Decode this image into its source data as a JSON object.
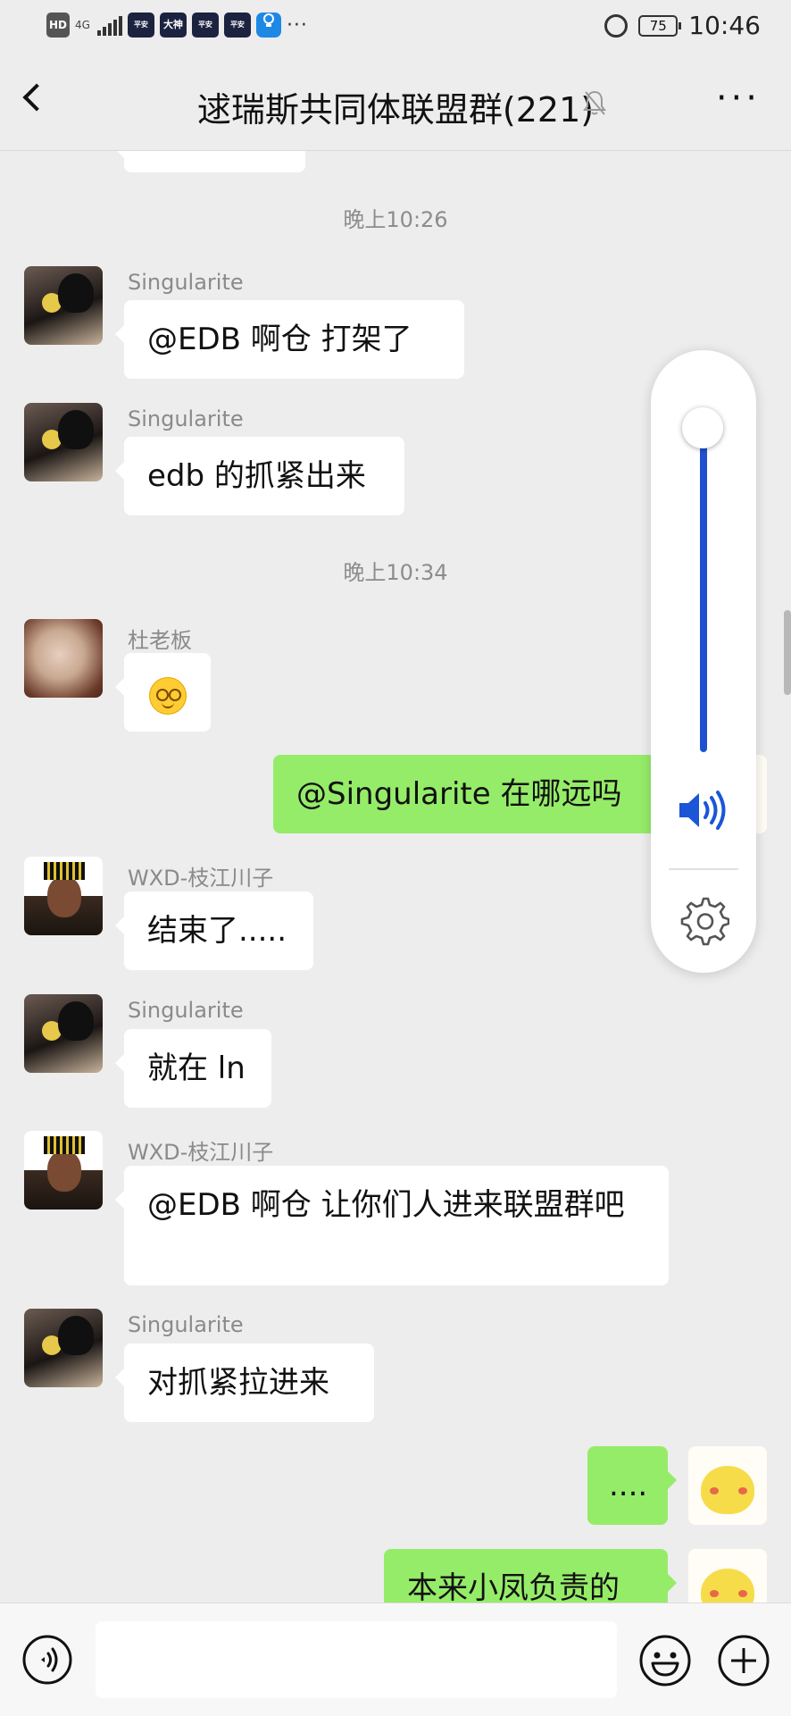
{
  "status_bar": {
    "hd": "HD",
    "network": "4G",
    "app_badges": [
      "平安",
      "大神",
      "平安",
      "平安"
    ],
    "battery": "75",
    "time": "10:46",
    "more": "···"
  },
  "header": {
    "title": "逑瑞斯共同体联盟群(221)"
  },
  "messages": {
    "t1": "晚上10:26",
    "m1": {
      "sender": "Singularite",
      "text": "@EDB 啊仓  打架了"
    },
    "m2": {
      "sender": "Singularite",
      "text": "edb 的抓紧出来"
    },
    "t2": "晚上10:34",
    "m3": {
      "sender": "杜老板",
      "emoji": "smirk-emoji"
    },
    "m4": {
      "text": "@Singularite  在哪远吗"
    },
    "m5": {
      "sender": "WXD-枝江川子",
      "text": "结束了....."
    },
    "m6": {
      "sender": "Singularite",
      "text": "就在 ln"
    },
    "m7": {
      "sender": "WXD-枝江川子",
      "text": "@EDB 啊仓  让你们人进来联盟群吧"
    },
    "m8": {
      "sender": "Singularite",
      "text": "对抓紧拉进来"
    },
    "m9": {
      "text": "...."
    },
    "m10": {
      "text": "本来小凤负责的"
    }
  },
  "volume": {
    "level": 0.98
  },
  "colors": {
    "accent": "#95ec69",
    "volume": "#2050d0",
    "background": "#ededed"
  }
}
